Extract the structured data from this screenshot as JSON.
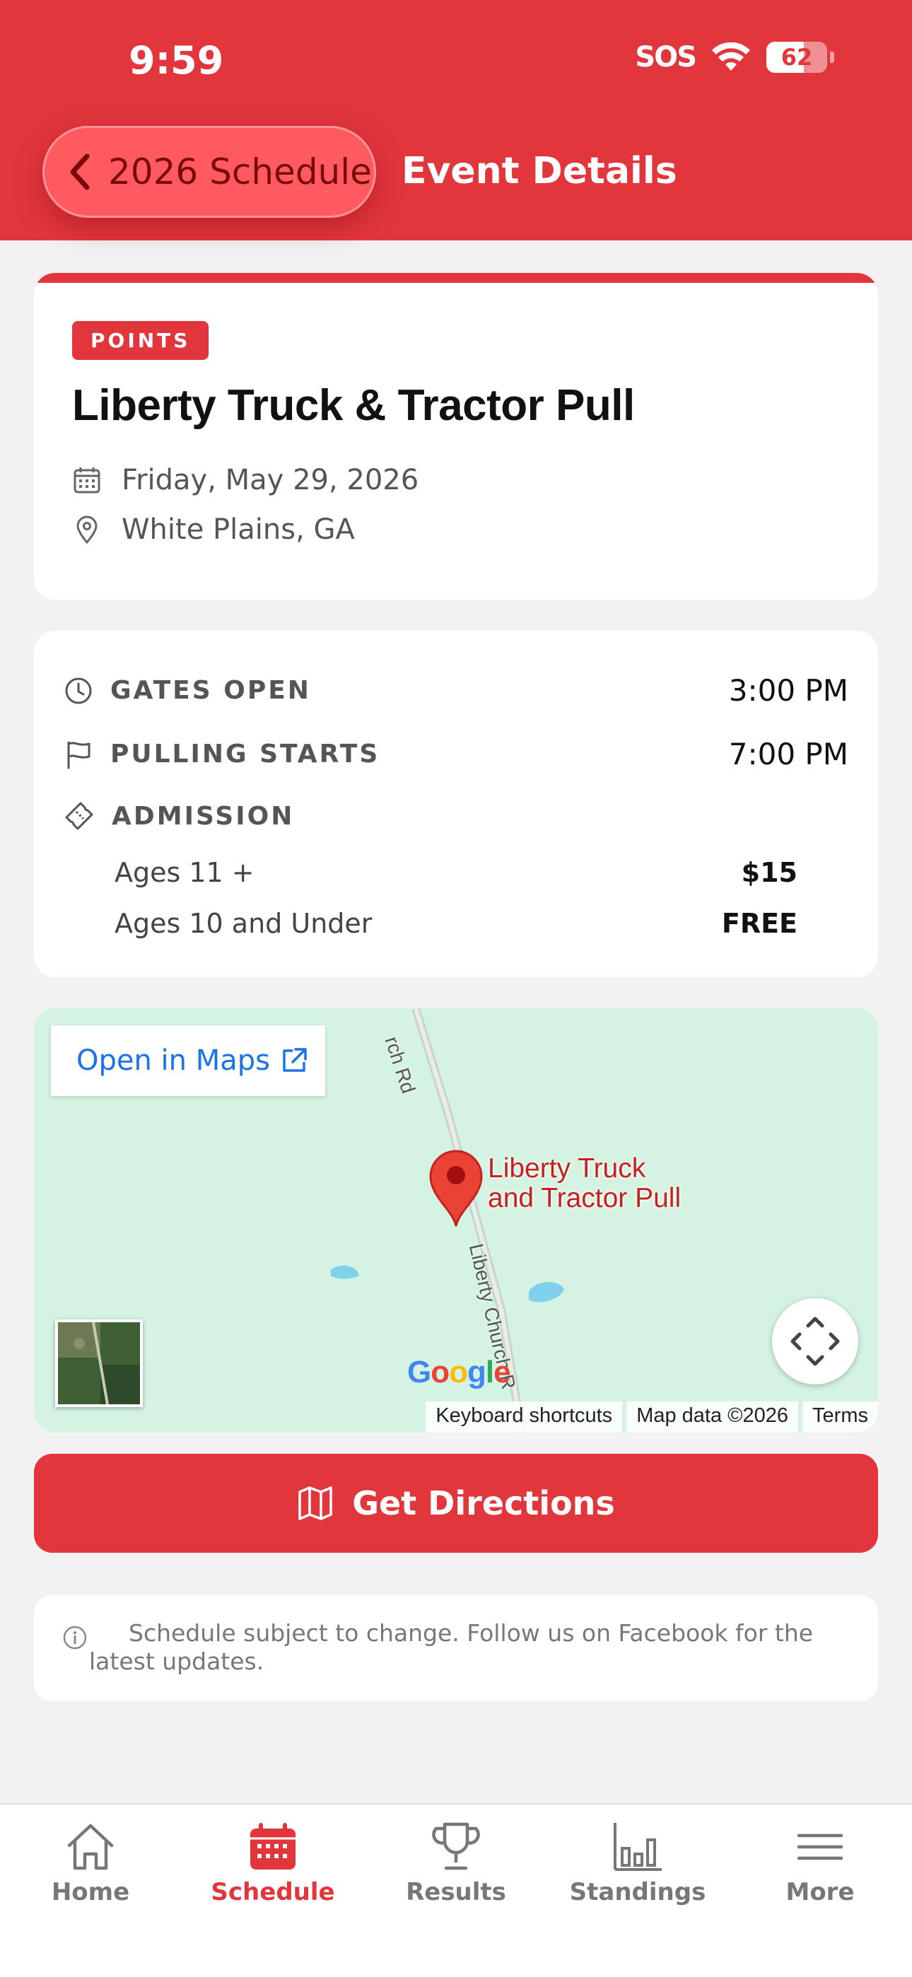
{
  "status_bar": {
    "time": "9:59",
    "sos": "SOS",
    "battery_percent": 62
  },
  "nav": {
    "back_label": "2026 Schedule",
    "title": "Event Details"
  },
  "event": {
    "badge": "POINTS",
    "name": "Liberty Truck & Tractor Pull",
    "date": "Friday, May 29, 2026",
    "location": "White Plains, GA"
  },
  "details": {
    "gates_label": "GATES OPEN",
    "gates_time": "3:00 PM",
    "pulling_label": "PULLING STARTS",
    "pulling_time": "7:00 PM",
    "admission_label": "ADMISSION",
    "prices": [
      {
        "label": "Ages 11 +",
        "value": "$15"
      },
      {
        "label": "Ages 10 and Under",
        "value": "FREE"
      }
    ]
  },
  "map": {
    "open_label": "Open in Maps",
    "pin_line1": "Liberty Truck",
    "pin_line2": "and Tractor Pull",
    "road_top": "rch Rd",
    "road_main": "Liberty Church R",
    "google": "Google",
    "footer": [
      "Keyboard shortcuts",
      "Map data ©2026",
      "Terms"
    ]
  },
  "directions_label": "Get Directions",
  "notice": "Schedule subject to change. Follow us on Facebook for the latest updates.",
  "tabs": [
    {
      "label": "Home",
      "icon": "home-icon"
    },
    {
      "label": "Schedule",
      "icon": "calendar-icon",
      "active": true
    },
    {
      "label": "Results",
      "icon": "trophy-icon"
    },
    {
      "label": "Standings",
      "icon": "bar-chart-icon"
    },
    {
      "label": "More",
      "icon": "menu-icon"
    }
  ],
  "colors": {
    "brand": "#e2363d",
    "map_bg": "#d4f3e2",
    "link": "#1a73e8"
  }
}
